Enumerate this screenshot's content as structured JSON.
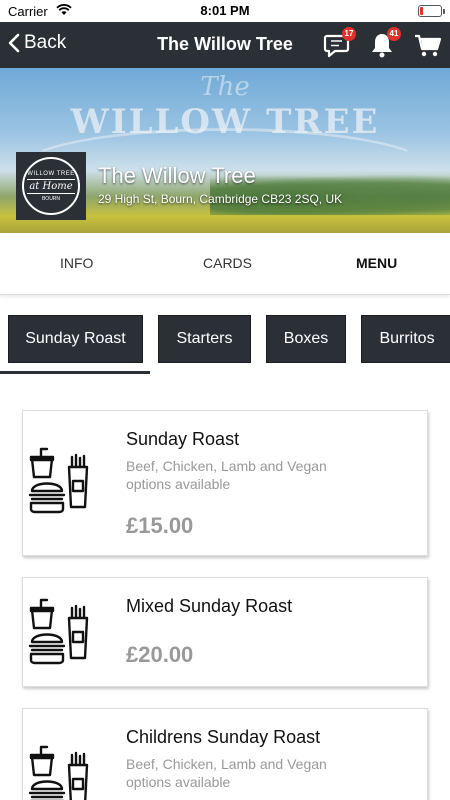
{
  "status_bar": {
    "carrier": "Carrier",
    "time": "8:01 PM",
    "battery_level": 0.1
  },
  "nav": {
    "back_label": "Back",
    "title": "The Willow Tree",
    "chat_badge": "17",
    "bell_badge": "41"
  },
  "hero": {
    "banner_script": "The",
    "banner_text": "WILLOW TREE",
    "logo": {
      "line1": "WILLOW TREE",
      "line2": "at Home",
      "line3": "BOURN"
    },
    "name": "The Willow Tree",
    "address": "29 High St, Bourn, Cambridge CB23 2SQ, UK"
  },
  "tabs": [
    "INFO",
    "CARDS",
    "MENU"
  ],
  "active_tab": "MENU",
  "categories": [
    "Sunday Roast",
    "Starters",
    "Boxes",
    "Burritos"
  ],
  "menu_items": [
    {
      "name": "Sunday Roast",
      "description": "Beef, Chicken, Lamb and Vegan options available",
      "price": "£15.00",
      "icon": "fast-food-icon"
    },
    {
      "name": "Mixed Sunday Roast",
      "description": "",
      "price": "£20.00",
      "icon": "fast-food-icon"
    },
    {
      "name": "Childrens Sunday Roast",
      "description": "Beef, Chicken, Lamb and Vegan options available",
      "price": "",
      "icon": "fast-food-icon"
    }
  ],
  "colors": {
    "header": "#2b2f36",
    "badge": "#e0322c",
    "price": "#999999"
  }
}
